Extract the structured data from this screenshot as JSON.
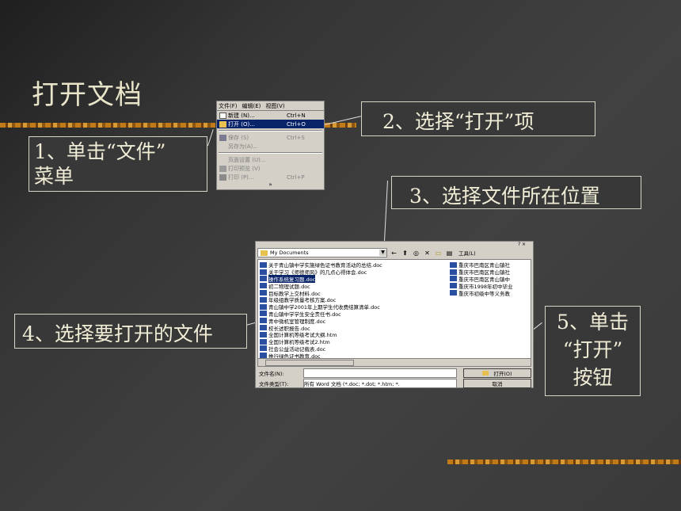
{
  "slide": {
    "title": "打开文档"
  },
  "callouts": {
    "step1_line1": "1、单击“文件”",
    "step1_line2": "菜单",
    "step2": "2、选择“打开”项",
    "step3": "3、选择文件所在位置",
    "step4": "4、选择要打开的文件",
    "step5_line1": "5、单击",
    "step5_line2": "“打开”",
    "step5_line3": "按钮"
  },
  "menu": {
    "bar": [
      "文件(F)",
      "编辑(E)",
      "视图(V)"
    ],
    "items": [
      {
        "label": "新建 (N)...",
        "shortcut": "Ctrl+N"
      },
      {
        "label": "打开 (O)...",
        "shortcut": "Ctrl+O"
      },
      {
        "label": "保存 (S)",
        "shortcut": "Ctrl+S"
      },
      {
        "label": "另存为(A)...",
        "shortcut": ""
      },
      {
        "label": "页面设置 (U)...",
        "shortcut": ""
      },
      {
        "label": "打印预览 (V)",
        "shortcut": ""
      },
      {
        "label": "打印 (P)...",
        "shortcut": "Ctrl+P"
      }
    ],
    "more": "»"
  },
  "dialog": {
    "look_in": "My Documents",
    "tools_label": "工具(L)",
    "files_left": [
      "关于青山镇中学实施绿色证书教育活动的总结.doc",
      "关于学习《师德师风》的几点心得体会.doc",
      "操作系统复习题.doc",
      "初二物理试题.doc",
      "目标教学上交材料.doc",
      "年级组教学质量考核方案.doc",
      "青山镇中学2001年上期学生代收费结算清单.doc",
      "青山镇中学学生安全责任书.doc",
      "青中微机室管理制度.doc",
      "校长述职报告.doc",
      "全国计算机等级考试大纲.htm",
      "全国计算机等级考试2.htm",
      "社会公益活动记载表.doc",
      "推行绿色证书教育.doc"
    ],
    "files_right": [
      "重庆市巴南区青山镇社",
      "重庆市巴南区青山镇社",
      "重庆市巴南区青山镇中",
      "重庆市1998年初中毕业",
      "重庆市初级中等义务教"
    ],
    "filename_label": "文件名(N):",
    "filename_value": "",
    "filetype_label": "文件类型(T):",
    "filetype_value": "所有 Word 文档 (*.doc; *.dot; *.htm; *.",
    "open_button": "打开(O)",
    "cancel_button": "取消"
  },
  "colors": {
    "background": "#3b3b3b",
    "title_text": "#e8e4c8",
    "accent_gold": "#c07a18",
    "selection": "#0a246a"
  }
}
